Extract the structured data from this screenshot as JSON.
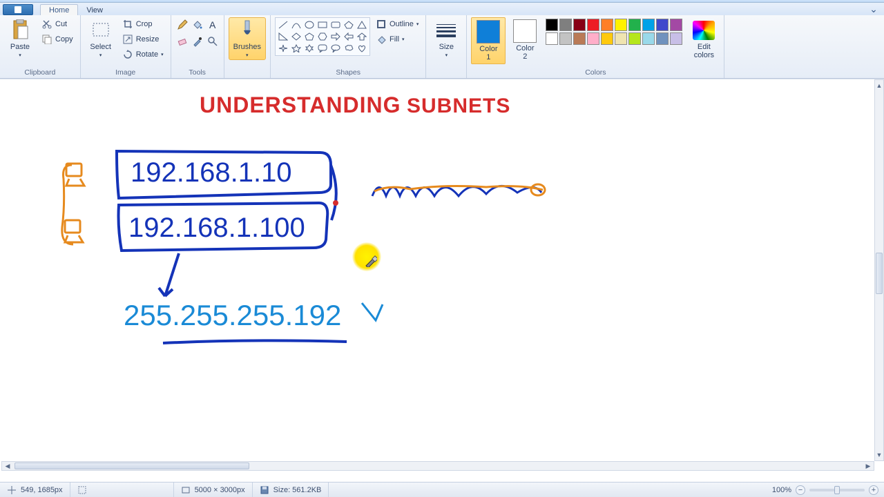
{
  "app": {
    "title": "Paint"
  },
  "tabs": {
    "home": "Home",
    "view": "View"
  },
  "ribbon": {
    "clipboard": {
      "label": "Clipboard",
      "paste": "Paste",
      "cut": "Cut",
      "copy": "Copy"
    },
    "image": {
      "label": "Image",
      "select": "Select",
      "crop": "Crop",
      "resize": "Resize",
      "rotate": "Rotate"
    },
    "tools": {
      "label": "Tools"
    },
    "brushes": {
      "label": "Brushes"
    },
    "shapes": {
      "label": "Shapes",
      "outline": "Outline",
      "fill": "Fill"
    },
    "size": {
      "label": "Size"
    },
    "colors": {
      "label": "Colors",
      "color1": "Color\n1",
      "color2": "Color\n2",
      "edit": "Edit\ncolors",
      "color1_value": "#0f7fd8",
      "color2_value": "#ffffff",
      "palette_row1": [
        "#000000",
        "#7f7f7f",
        "#880015",
        "#ed1c24",
        "#ff7f27",
        "#fff200",
        "#22b14c",
        "#00a2e8",
        "#3f48cc",
        "#a349a4"
      ],
      "palette_row2": [
        "#ffffff",
        "#c3c3c3",
        "#b97a57",
        "#ffaec9",
        "#ffc90e",
        "#efe4b0",
        "#b5e61d",
        "#99d9ea",
        "#7092be",
        "#c8bfe7"
      ]
    }
  },
  "canvas": {
    "title_text": "UNDERSTANDING   SUBNETS",
    "ip1": "192.168.1.10",
    "ip2": "192.168.1.100",
    "subnet": "255.255.255.192",
    "cursor_pos": "549, 1685px",
    "canvas_dims": "5000 × 3000px",
    "file_size": "Size: 561.2KB"
  },
  "status": {
    "zoom": "100%"
  }
}
